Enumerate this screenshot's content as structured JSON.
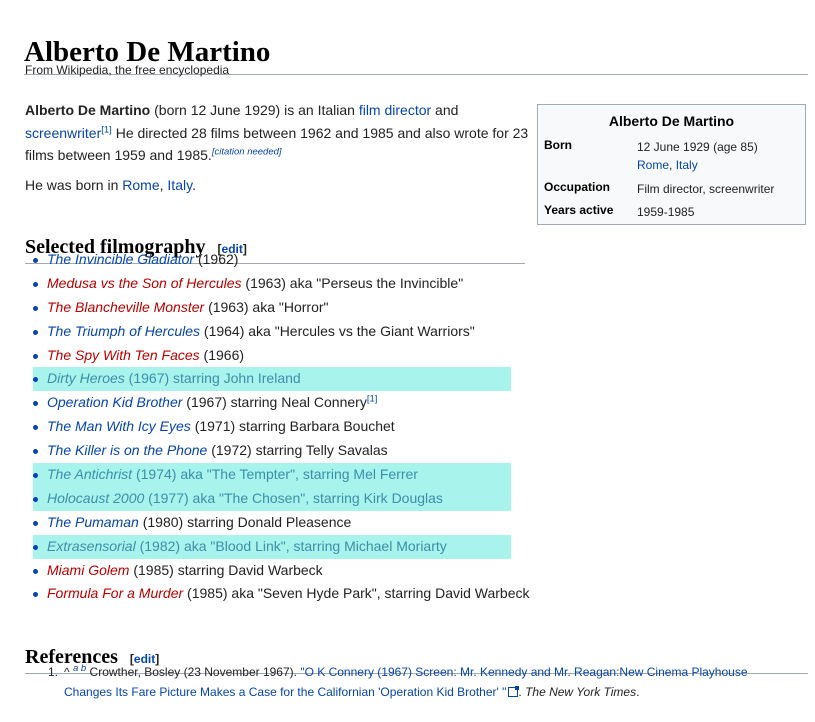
{
  "page": {
    "title": "Alberto De Martino",
    "tagline": "From Wikipedia, the free encyclopedia"
  },
  "intro": {
    "subject": "Alberto De Martino",
    "t1": " (born 12 June 1929) is an Italian ",
    "link_director": "film director",
    "t2": " and ",
    "link_screenwriter": "screenwriter",
    "ref1": "[1]",
    "t3": " He directed 28 films between 1962 and 1985 and also wrote for 23 films between 1959 and 1985.",
    "citation": "[citation needed]",
    "born_prefix": "He was born in ",
    "born_rome": "Rome",
    "born_sep": ", ",
    "born_italy": "Italy",
    "born_suffix": "."
  },
  "infobox": {
    "title": "Alberto De Martino",
    "born_label": "Born",
    "born_date": "12 June 1929 (age 85)",
    "born_rome": "Rome",
    "born_sep": ", ",
    "born_italy": "Italy",
    "occupation_label": "Occupation",
    "occupation_value": "Film director, screenwriter",
    "years_label": "Years active",
    "years_value": "1959-1985"
  },
  "filmography": {
    "heading": "Selected filmography",
    "edit_open": "[",
    "edit_label": "edit",
    "edit_close": "]",
    "items": [
      {
        "title": "The Invincible Gladiator",
        "rest": " (1962)",
        "color": "blue",
        "highlight": false
      },
      {
        "title": "Medusa vs the Son of Hercules",
        "rest": " (1963) aka \"Perseus the Invincible\"",
        "color": "red",
        "highlight": false
      },
      {
        "title": "The Blancheville Monster",
        "rest": " (1963) aka \"Horror\"",
        "color": "red",
        "highlight": false
      },
      {
        "title": "The Triumph of Hercules",
        "rest": " (1964) aka \"Hercules vs the Giant Warriors\"",
        "color": "blue",
        "highlight": false
      },
      {
        "title": "The Spy With Ten Faces",
        "rest": " (1966)",
        "color": "red",
        "highlight": false
      },
      {
        "title": "Dirty Heroes",
        "rest": " (1967) starring John Ireland",
        "color": "blue",
        "highlight": true
      },
      {
        "title": "Operation Kid Brother",
        "rest": " (1967) starring Neal Connery",
        "sup": "[1]",
        "color": "blue",
        "highlight": false
      },
      {
        "title": "The Man With Icy Eyes",
        "rest": " (1971) starring Barbara Bouchet",
        "color": "blue",
        "highlight": false
      },
      {
        "title": "The Killer is on the Phone",
        "rest": " (1972) starring Telly Savalas",
        "color": "blue",
        "highlight": false
      },
      {
        "title": "The Antichrist",
        "rest": " (1974) aka \"The Tempter\", starring Mel Ferrer",
        "color": "blue",
        "highlight": true
      },
      {
        "title": "Holocaust 2000",
        "rest": " (1977) aka \"The Chosen\", starring Kirk Douglas",
        "color": "blue",
        "highlight": true
      },
      {
        "title": "The Pumaman",
        "rest": " (1980) starring Donald Pleasence",
        "color": "blue",
        "highlight": false
      },
      {
        "title": "Extrasensorial",
        "rest": " (1982) aka \"Blood Link\", starring Michael Moriarty",
        "color": "grey",
        "highlight": true
      },
      {
        "title": "Miami Golem",
        "rest": " (1985) starring David Warbeck",
        "color": "red",
        "highlight": false
      },
      {
        "title": "Formula For a Murder",
        "rest": " (1985) aka \"Seven Hyde Park\", starring David Warbeck",
        "color": "red",
        "highlight": false
      }
    ]
  },
  "references": {
    "heading": "References",
    "edit_open": "[",
    "edit_label": "edit",
    "edit_close": "]",
    "items": [
      {
        "num": "1.",
        "caret": "^",
        "backlink_a": "a",
        "backlink_b": "b",
        "author": " Crowther, Bosley (23 November 1967). ",
        "link_title": "\"O K Connery (1967) Screen: Mr. Kennedy and Mr. Reagan:New Cinema Playhouse Changes Its Fare Picture Makes a Case for the Californian 'Operation Kid Brother' \"",
        "sep": ". ",
        "publication": "The New York Times",
        "end": "."
      }
    ]
  },
  "colors": {
    "link": "#0645ad",
    "redlink": "#ba0000",
    "highlight": "#a8f3ec",
    "rule": "#a2a9b1"
  }
}
